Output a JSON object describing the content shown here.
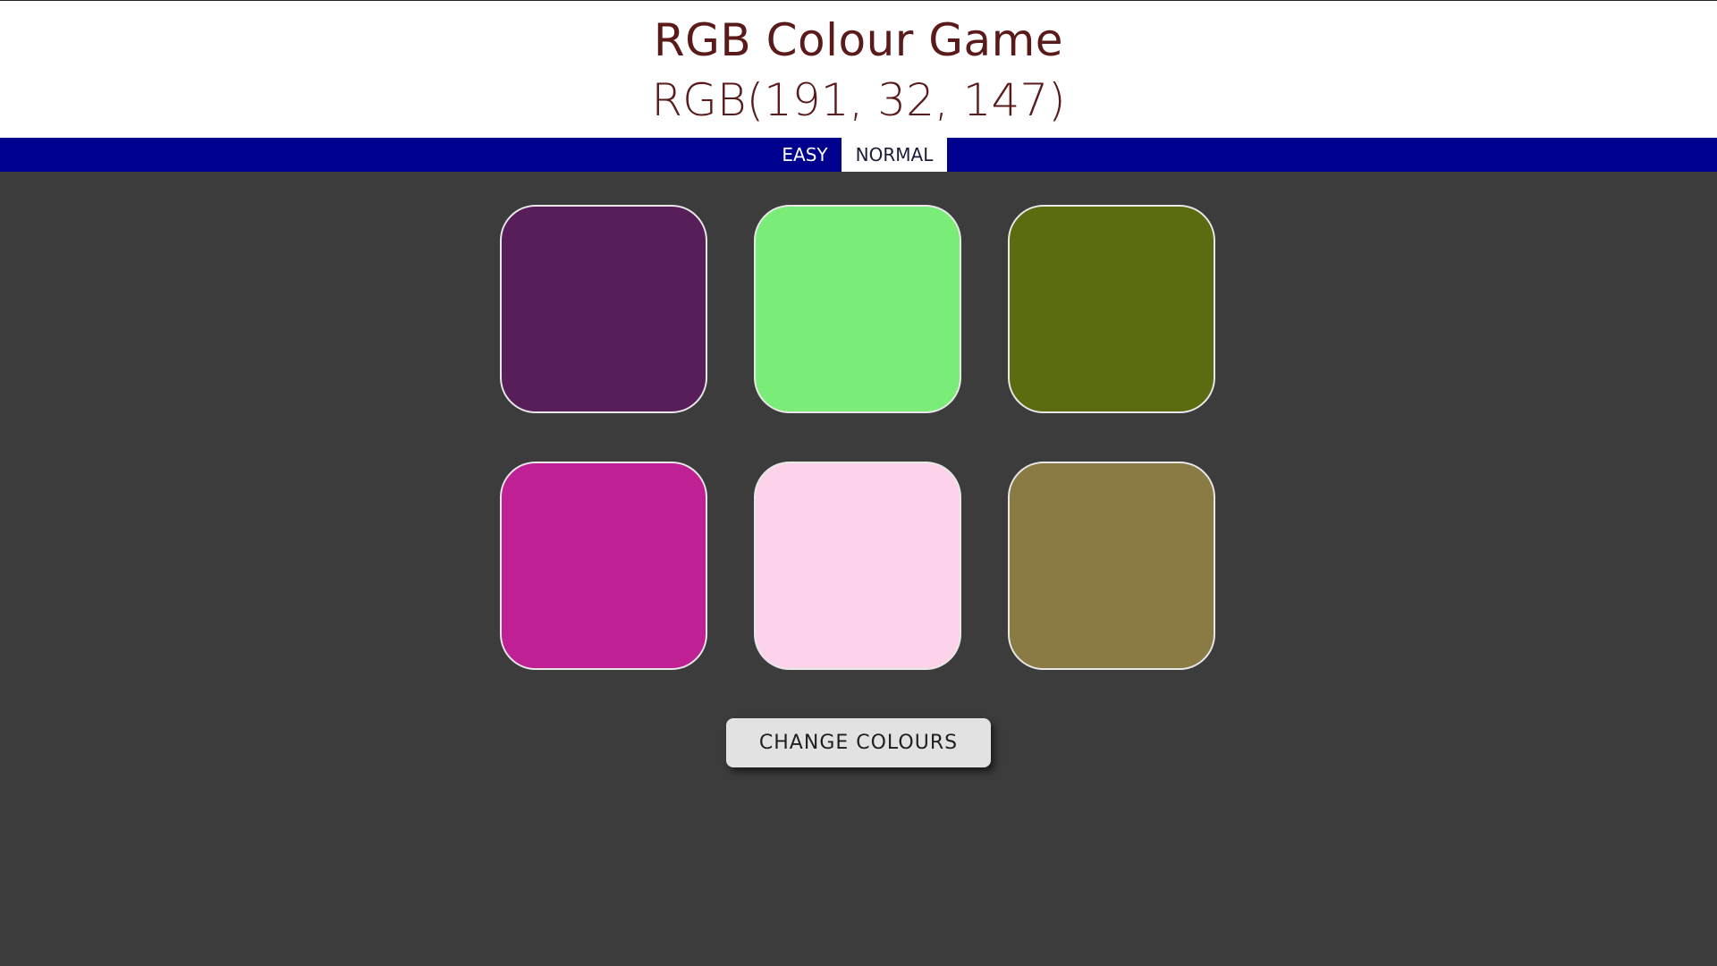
{
  "header": {
    "title": "RGB Colour Game",
    "target_rgb": "RGB(191, 32, 147)"
  },
  "modes": {
    "easy_label": "EASY",
    "normal_label": "NORMAL",
    "selected": "NORMAL"
  },
  "squares": [
    {
      "color": "#571e5a"
    },
    {
      "color": "#79ed77"
    },
    {
      "color": "#5b6b10"
    },
    {
      "color": "#bf2093"
    },
    {
      "color": "#fdd3eb"
    },
    {
      "color": "#8a7b45"
    }
  ],
  "reset": {
    "label": "CHANGE COLOURS"
  },
  "colors": {
    "header_text": "#5a1a1a",
    "navbar_bg": "#00008f",
    "page_bg": "#3c3c3c"
  }
}
